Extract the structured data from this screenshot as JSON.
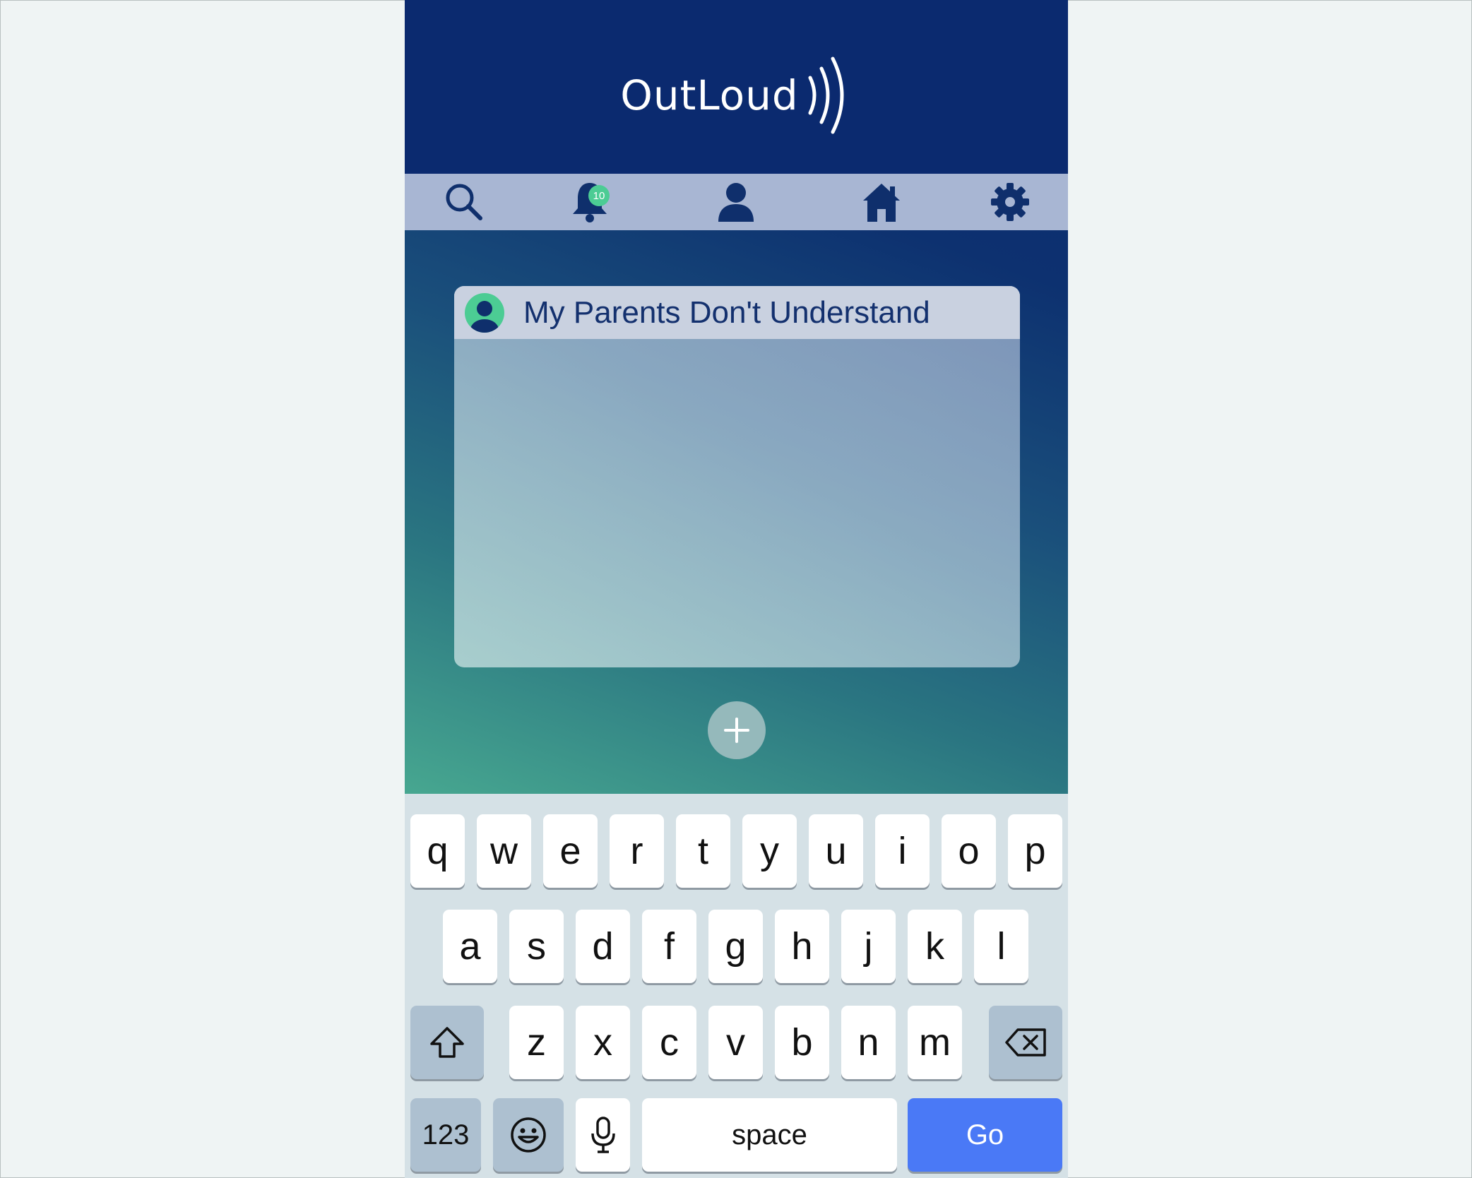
{
  "app": {
    "logo_text": "OutLoud",
    "brand_colors": {
      "header": "#0b2a6f",
      "navbar": "#a8b6d3",
      "accent_green": "#4ccc94",
      "icon_navy": "#0f2f6c",
      "go_blue": "#4a79f6"
    }
  },
  "nav": {
    "items": [
      {
        "name": "search",
        "icon": "search-icon"
      },
      {
        "name": "notifications",
        "icon": "bell-icon",
        "badge": "10"
      },
      {
        "name": "profile",
        "icon": "user-icon"
      },
      {
        "name": "home",
        "icon": "home-icon"
      },
      {
        "name": "settings",
        "icon": "gear-icon"
      }
    ]
  },
  "post": {
    "title": "My Parents Don't Understand",
    "avatar_icon": "user-avatar-icon",
    "body": ""
  },
  "add_button": {
    "icon": "plus-icon"
  },
  "keyboard": {
    "row1": [
      "q",
      "w",
      "e",
      "r",
      "t",
      "y",
      "u",
      "i",
      "o",
      "p"
    ],
    "row2": [
      "a",
      "s",
      "d",
      "f",
      "g",
      "h",
      "j",
      "k",
      "l"
    ],
    "row3": [
      "z",
      "x",
      "c",
      "v",
      "b",
      "n",
      "m"
    ],
    "shift_icon": "shift-icon",
    "backspace_icon": "backspace-icon",
    "numbers_label": "123",
    "emoji_icon": "emoji-icon",
    "mic_icon": "microphone-icon",
    "space_label": "space",
    "go_label": "Go"
  }
}
